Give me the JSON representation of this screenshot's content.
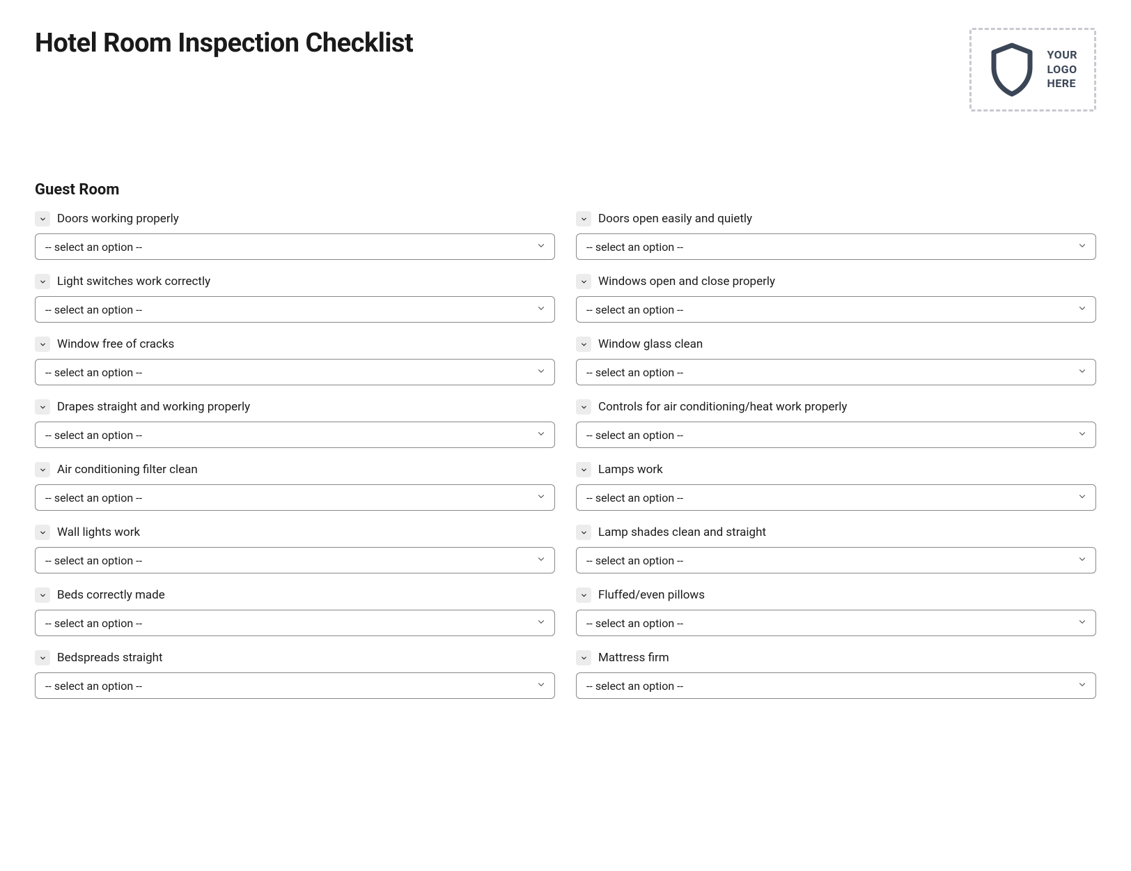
{
  "page_title": "Hotel Room Inspection Checklist",
  "logo_placeholder": {
    "line1": "YOUR",
    "line2": "LOGO",
    "line3": "HERE"
  },
  "section": {
    "title": "Guest Room"
  },
  "select_placeholder": "-- select an option --",
  "items": [
    {
      "label": "Doors working properly"
    },
    {
      "label": "Doors open easily and quietly"
    },
    {
      "label": "Light switches work correctly"
    },
    {
      "label": "Windows open and close properly"
    },
    {
      "label": "Window free of cracks"
    },
    {
      "label": "Window glass clean"
    },
    {
      "label": "Drapes straight and working properly"
    },
    {
      "label": "Controls for air conditioning/heat work properly"
    },
    {
      "label": "Air conditioning filter clean"
    },
    {
      "label": "Lamps work"
    },
    {
      "label": "Wall lights work"
    },
    {
      "label": "Lamp shades clean and straight"
    },
    {
      "label": "Beds correctly made"
    },
    {
      "label": "Fluffed/even pillows"
    },
    {
      "label": "Bedspreads straight"
    },
    {
      "label": "Mattress firm"
    }
  ]
}
